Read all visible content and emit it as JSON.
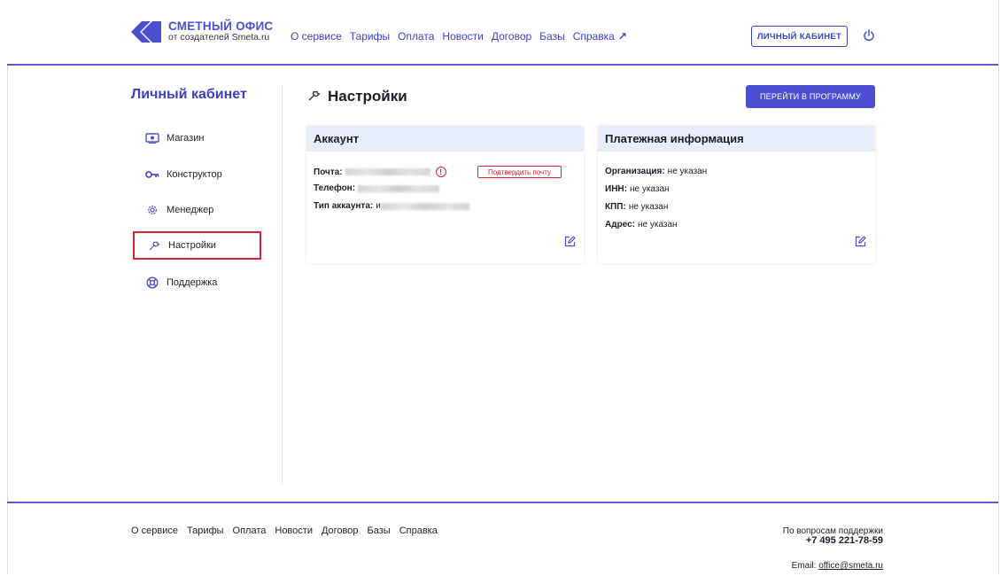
{
  "header": {
    "logo_title": "СМЕТНЫЙ ОФИС",
    "logo_subtitle": "от создателей Smeta.ru",
    "nav": [
      "О сервисе",
      "Тарифы",
      "Оплата",
      "Новости",
      "Договор",
      "Базы",
      "Справка"
    ],
    "nav_external_icon": "↗",
    "cabinet_button": "ЛИЧНЫЙ КАБИНЕТ"
  },
  "sidebar": {
    "title": "Личный кабинет",
    "items": [
      {
        "label": "Магазин",
        "icon": "store-icon"
      },
      {
        "label": "Конструктор",
        "icon": "key-icon"
      },
      {
        "label": "Менеджер",
        "icon": "gear-icon"
      },
      {
        "label": "Настройки",
        "icon": "wrench-icon",
        "active": true
      },
      {
        "label": "Поддержка",
        "icon": "lifebuoy-icon"
      }
    ]
  },
  "main": {
    "title": "Настройки",
    "go_button": "ПЕРЕЙТИ В ПРОГРАММУ",
    "account": {
      "heading": "Аккаунт",
      "email_label": "Почта:",
      "phone_label": "Телефон:",
      "type_label": "Тип аккаунта:",
      "type_value_prefix": "и",
      "confirm_button": "Подтвердить почту",
      "warn_glyph": "!"
    },
    "payment": {
      "heading": "Платежная информация",
      "org_label": "Организация:",
      "org_value": "не указан",
      "inn_label": "ИНН:",
      "inn_value": "не указан",
      "kpp_label": "КПП:",
      "kpp_value": "не указан",
      "address_label": "Адрес:",
      "address_value": "не указан"
    }
  },
  "footer": {
    "nav": [
      "О сервисе",
      "Тарифы",
      "Оплата",
      "Новости",
      "Договор",
      "Базы",
      "Справка"
    ],
    "support_text": "По вопросам поддержки",
    "support_phone": "+7 495 221-78-59",
    "email_label": "Email:",
    "email_value": "office@smeta.ru"
  },
  "colors": {
    "accent": "#4c4fcf",
    "alert": "#d9232e",
    "card_header": "#e6eefb"
  }
}
